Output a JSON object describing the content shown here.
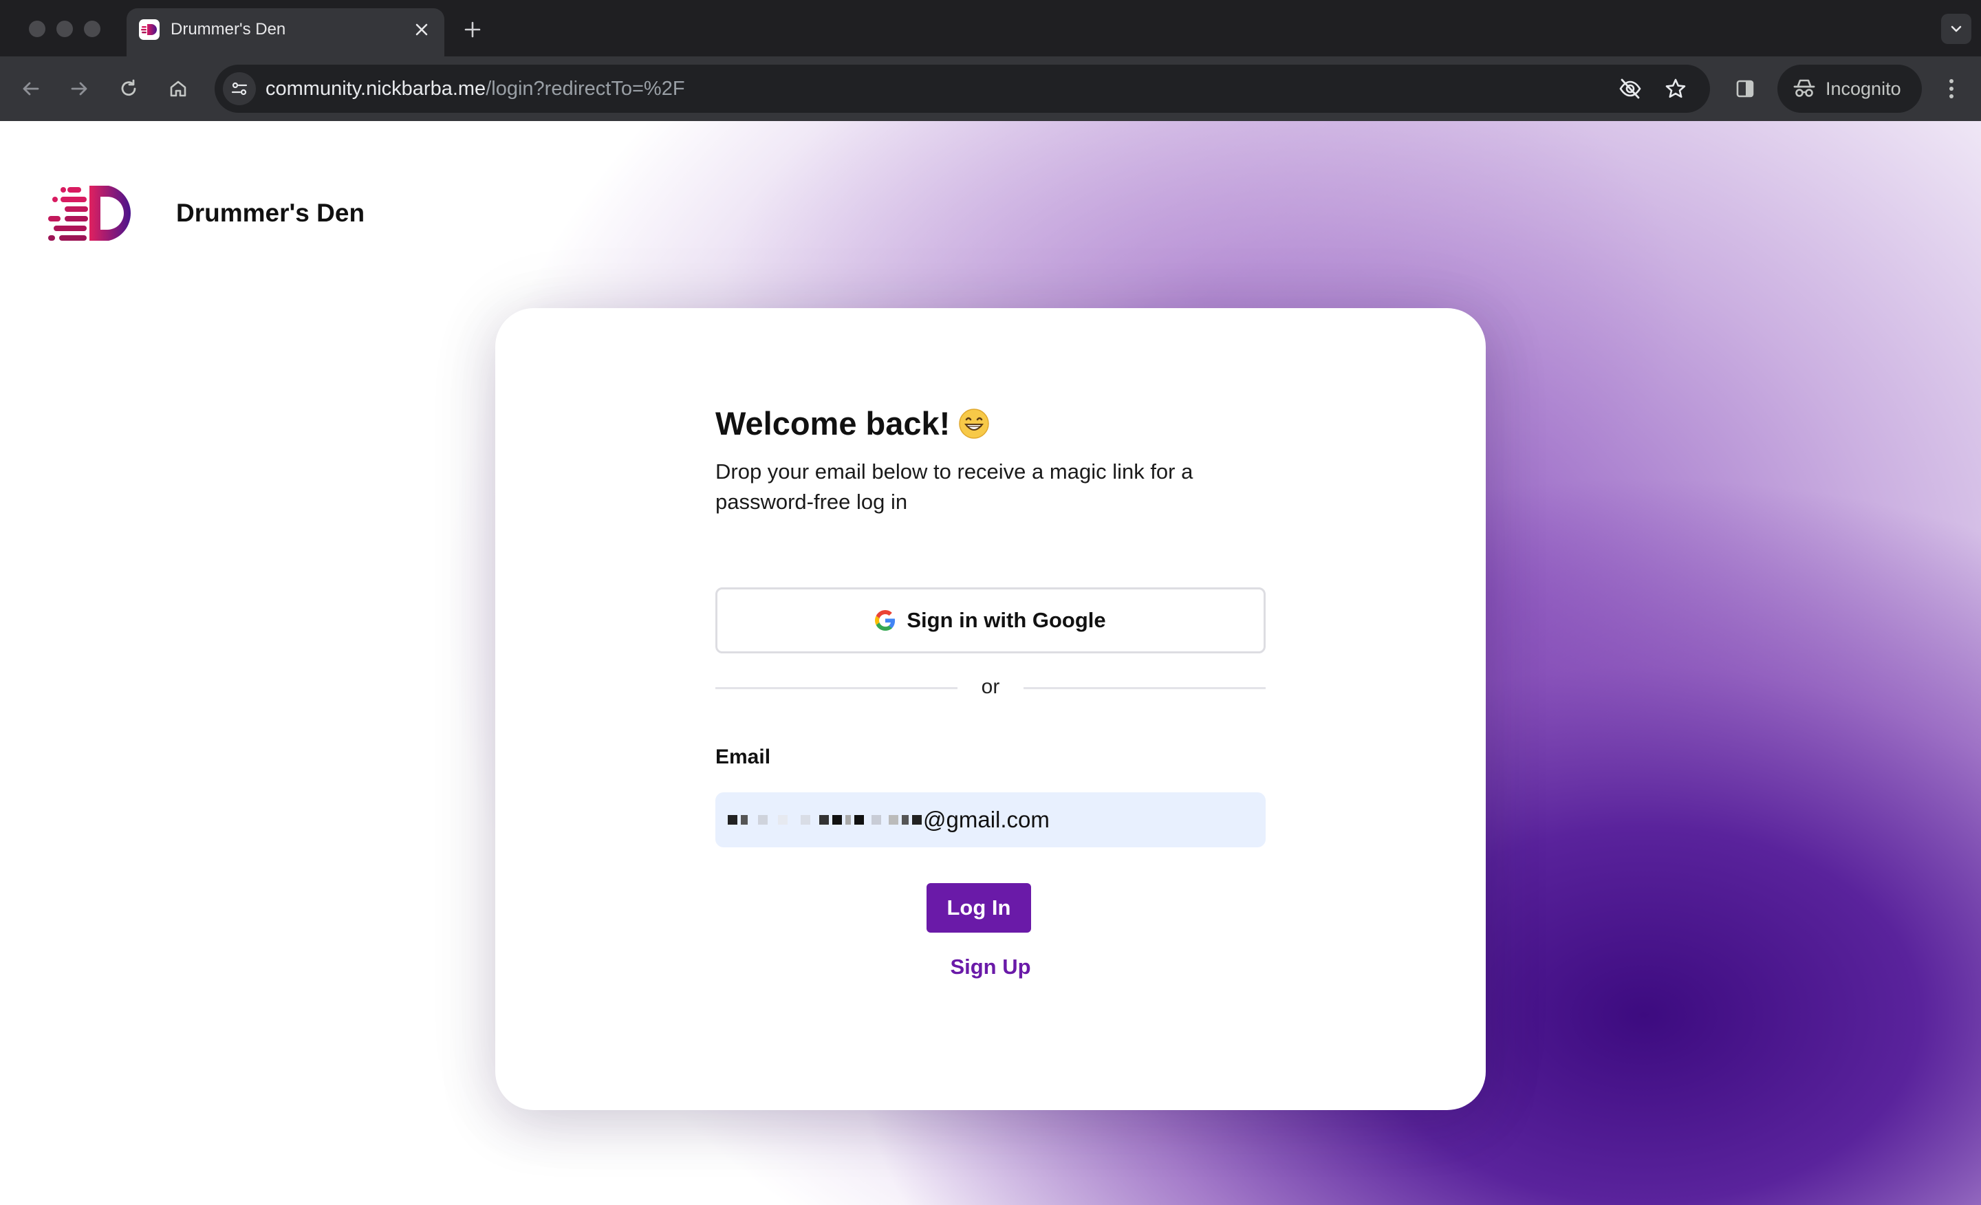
{
  "browser": {
    "tab_title": "Drummer's Den",
    "url_host": "community.nickbarba.me",
    "url_path": "/login?redirectTo=%2F",
    "incognito_label": "Incognito"
  },
  "page": {
    "brand_name": "Drummer's Den",
    "card": {
      "heading": "Welcome back!",
      "heading_emoji": "grinning-face-emoji",
      "subtitle": "Drop your email below to receive a magic link for a password-free log in",
      "google_button_label": "Sign in with Google",
      "divider_text": "or",
      "email_label": "Email",
      "email_value_visible": "@gmail.com",
      "login_button_label": "Log In",
      "signup_link_label": "Sign Up"
    }
  },
  "colors": {
    "accent": "#6a1aa8",
    "input_bg": "#e8f0fe",
    "logo_gradient_start": "#d81b60",
    "logo_gradient_end": "#4a148c"
  }
}
